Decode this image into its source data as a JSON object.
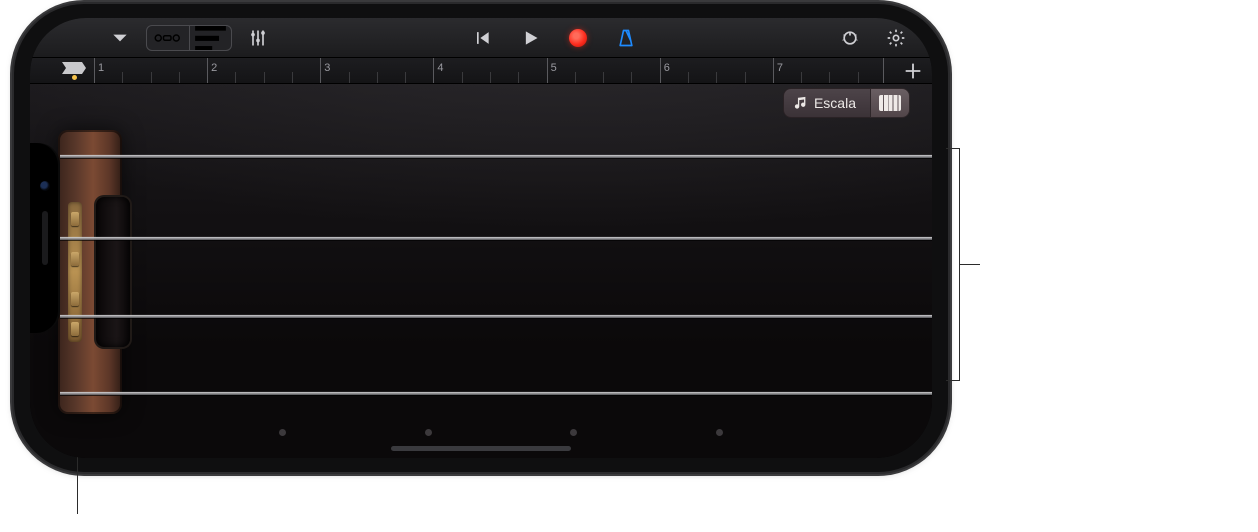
{
  "toolbar": {
    "left_group": {
      "menu_label": "menu",
      "browser_label": "browser",
      "tracks_label": "tracks",
      "mixer_label": "mixer"
    },
    "transport": {
      "rewind_label": "go-to-beginning",
      "play_label": "play",
      "record_label": "record",
      "metronome_label": "metronome"
    },
    "right_group": {
      "fx_label": "master-effects",
      "settings_label": "song-settings"
    }
  },
  "ruler": {
    "bars": [
      "1",
      "2",
      "3",
      "4",
      "5",
      "6",
      "7"
    ],
    "add_label": "+"
  },
  "view_tabs": {
    "scale_label": "Escala",
    "layout_label": "keyboard-layout"
  },
  "instrument": {
    "string_count": 4,
    "fret_dot_count": 4
  },
  "colors": {
    "record": "#ff2d1f",
    "metronome": "#1e8bff",
    "ruler_text": "#9a9aa0",
    "wood_light": "#7b4a33",
    "wood_dark": "#3a241c",
    "brass": "#b99252"
  }
}
